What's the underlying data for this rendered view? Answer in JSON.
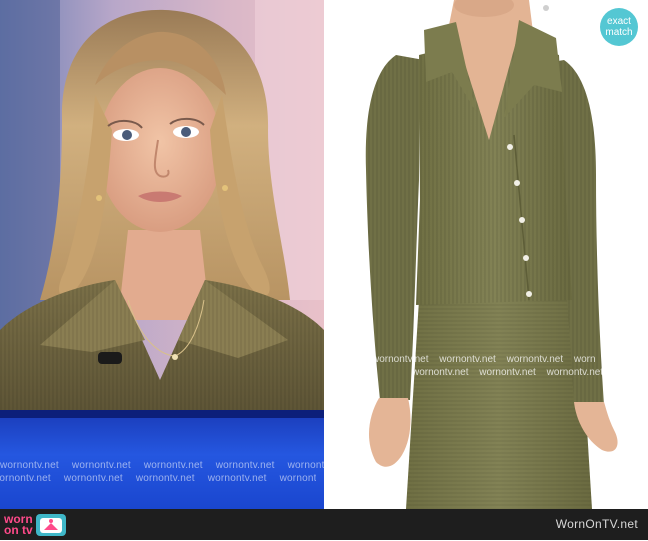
{
  "badge": {
    "line1": "exact",
    "line2": "match"
  },
  "watermark_text": "wornontv.net",
  "left_watermark_rows": [
    [
      "wornontv.net",
      "wornontv.net",
      "wornontv.net",
      "wornontv.net",
      "wornontv.net"
    ],
    [
      "wornontv.net",
      "wornontv.net",
      "wornontv.net",
      "wornontv.net",
      "wornontv.net"
    ]
  ],
  "right_watermark_rows": [
    [
      "wornontv.net",
      "wornontv.net",
      "wornontv.net",
      "worn"
    ],
    [
      "wornontv.net",
      "wornontv.net",
      "wornontv.net",
      "wornontv.net"
    ]
  ],
  "logo": {
    "word1": "worn",
    "word2": "on tv"
  },
  "footer": {
    "site": "WornOnTV.net"
  },
  "colors": {
    "badge": "#54c7d3",
    "logo_pink": "#ff4a8a",
    "logo_teal": "#3fb7c8",
    "cardigan_olive": "#7a7a4c",
    "chyron_blue": "#2557e0",
    "footer_bg": "#1e1e1e"
  }
}
